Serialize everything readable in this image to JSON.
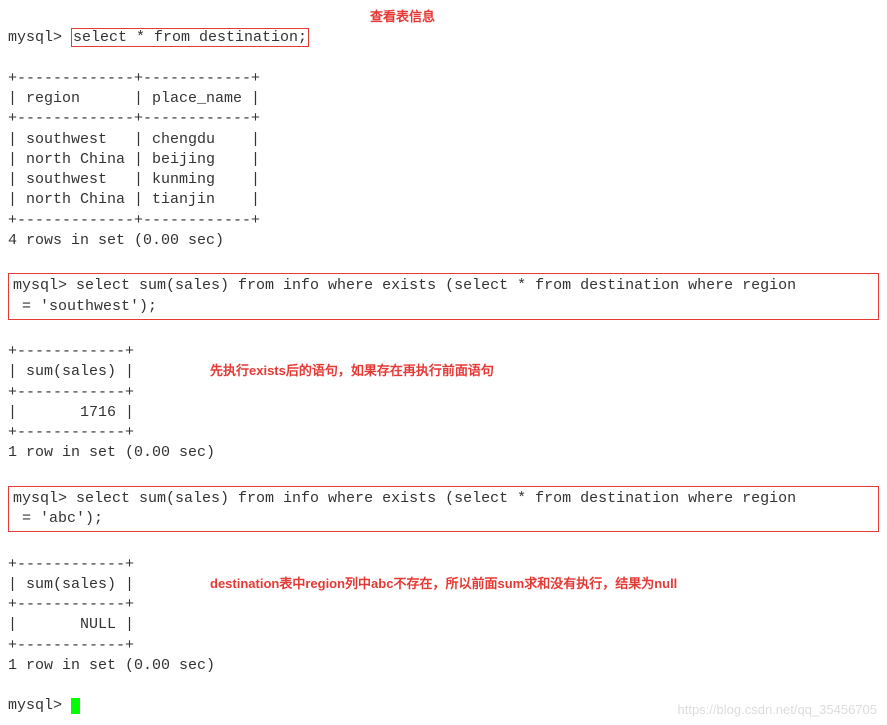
{
  "line1_prompt": "mysql> ",
  "line1_query": "select * from destination;",
  "anno1": "查看表信息",
  "table1_border_top": "+-------------+------------+",
  "table1_header": "| region      | place_name |",
  "table1_border_mid": "+-------------+------------+",
  "table1_rows": [
    "| southwest   | chengdu    |",
    "| north China | beijing    |",
    "| southwest   | kunming    |",
    "| north China | tianjin    |"
  ],
  "table1_border_bot": "+-------------+------------+",
  "table1_summary": "4 rows in set (0.00 sec)",
  "query2_prompt": "mysql> ",
  "query2_line1": "select sum(sales) from info where exists (select * from destination where region",
  "query2_line2": " = 'southwest');",
  "anno2": "先执行exists后的语句，如果存在再执行前面语句",
  "table2_border_top": "+------------+",
  "table2_header": "| sum(sales) |",
  "table2_border_mid": "+------------+",
  "table2_row": "|       1716 |",
  "table2_border_bot": "+------------+",
  "table2_summary": "1 row in set (0.00 sec)",
  "query3_prompt": "mysql> ",
  "query3_line1": "select sum(sales) from info where exists (select * from destination where region",
  "query3_line2": " = 'abc');",
  "anno3": "destination表中region列中abc不存在，所以前面sum求和没有执行，结果为null",
  "table3_border_top": "+------------+",
  "table3_header": "| sum(sales) |",
  "table3_border_mid": "+------------+",
  "table3_row": "|       NULL |",
  "table3_border_bot": "+------------+",
  "table3_summary": "1 row in set (0.00 sec)",
  "final_prompt": "mysql> ",
  "watermark": "https://blog.csdn.net/qq_35456705",
  "chart_data": {
    "type": "table",
    "tables": [
      {
        "title": "destination",
        "columns": [
          "region",
          "place_name"
        ],
        "rows": [
          [
            "southwest",
            "chengdu"
          ],
          [
            "north China",
            "beijing"
          ],
          [
            "southwest",
            "kunming"
          ],
          [
            "north China",
            "tianjin"
          ]
        ],
        "summary": "4 rows in set (0.00 sec)"
      },
      {
        "title": "sum(sales) where exists region='southwest'",
        "columns": [
          "sum(sales)"
        ],
        "rows": [
          [
            1716
          ]
        ],
        "summary": "1 row in set (0.00 sec)"
      },
      {
        "title": "sum(sales) where exists region='abc'",
        "columns": [
          "sum(sales)"
        ],
        "rows": [
          [
            "NULL"
          ]
        ],
        "summary": "1 row in set (0.00 sec)"
      }
    ]
  }
}
